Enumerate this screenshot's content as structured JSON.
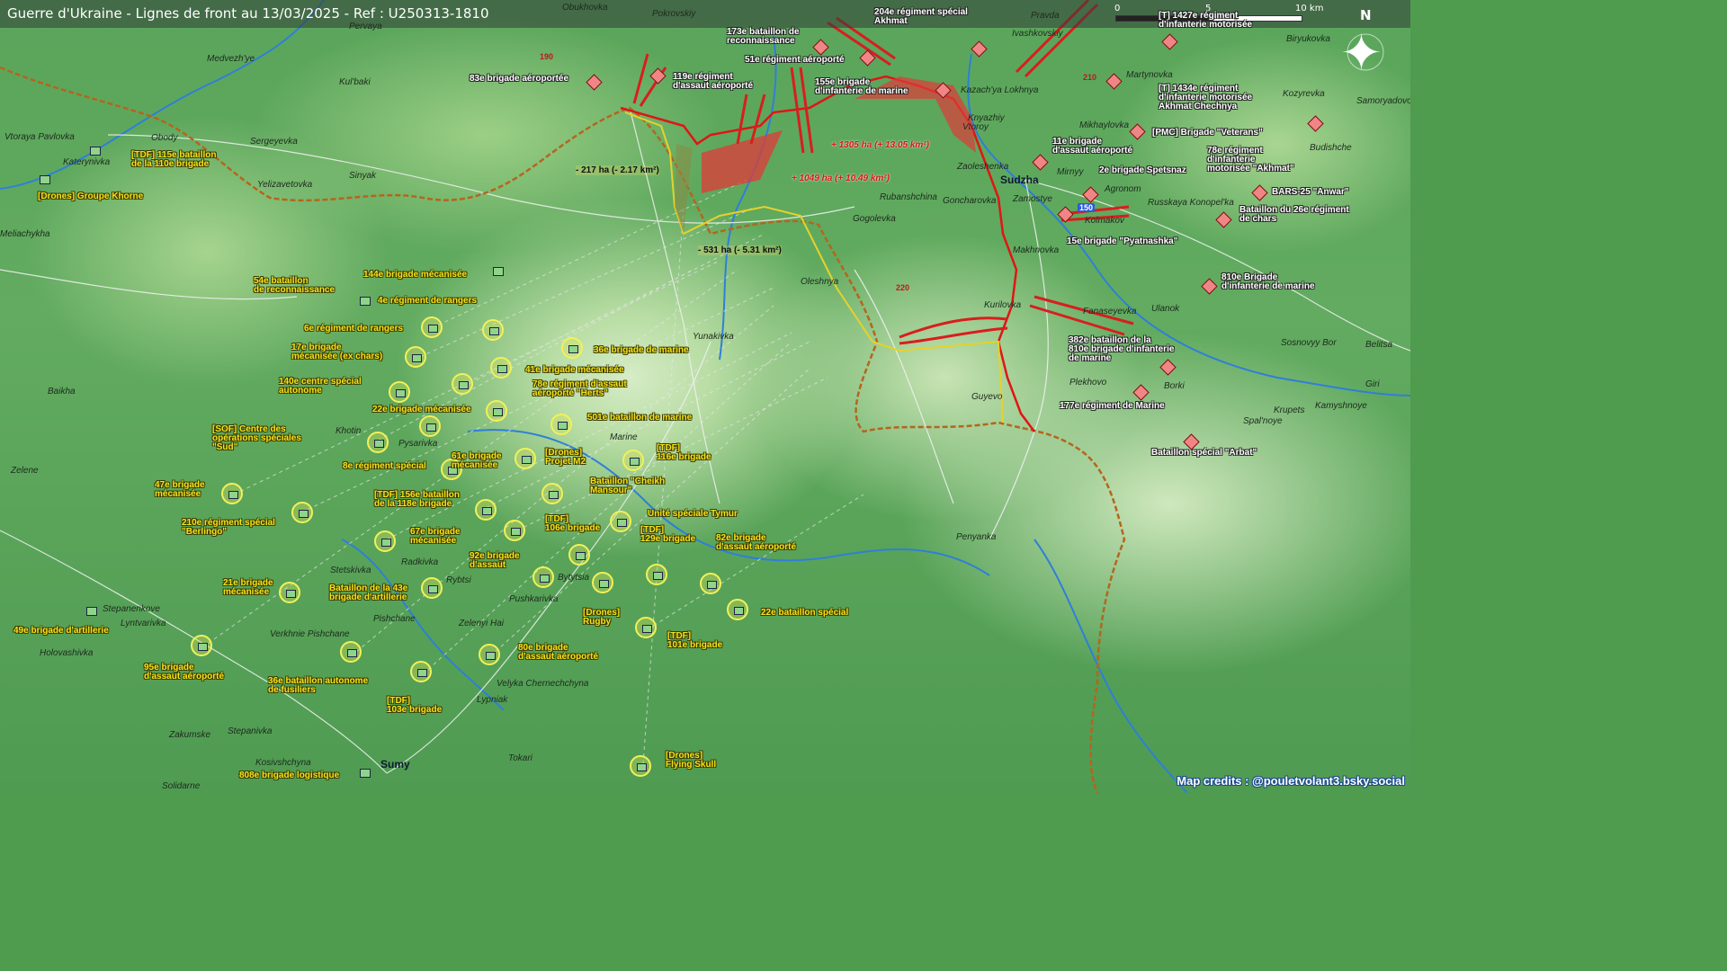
{
  "title": "Guerre d'Ukraine - Lignes de front au 13/03/2025 - Ref : U250313-1810",
  "scale": {
    "label0": "0",
    "label5": "5",
    "label10": "10 km"
  },
  "compass": "N",
  "credits": "Map credits : @pouletvolant3.bsky.social",
  "colors": {
    "russian_gain": "#e03a3a",
    "frontline": "#e01515",
    "ukraine_unit_text": "#f7e21b",
    "border": "#b5651d"
  },
  "gains": [
    {
      "text": "+ 1305 ha (+ 13.05 km²)"
    },
    {
      "text": "+ 1049 ha (+ 10.49 km²)"
    }
  ],
  "losses": [
    {
      "text": "- 217 ha (- 2.17 km²)"
    },
    {
      "text": "- 531 ha (- 5.31 km²)"
    }
  ],
  "roads": [
    "190",
    "210",
    "150",
    "220"
  ],
  "towns": [
    "Obukhovka",
    "Pokrovskiy",
    "Pervaya",
    "Pravda",
    "Ivashkovskiy",
    "Biryukovka",
    "Medvezh'ye",
    "Kul'baki",
    "Vtoraya Pavlovka",
    "Obody",
    "Katerynivka",
    "Sergeyevka",
    "Sinyak",
    "Yelizavetovka",
    "Meliachykha",
    "Kazach'ya Lokhnya",
    "Knyazhiy",
    "Vtoroy",
    "Zaoleshenka",
    "Sudzha",
    "Mirnyy",
    "Agronom",
    "Zamostye",
    "Goncharovka",
    "Rubanshchina",
    "Gogolevka",
    "Kolmakov",
    "Makhnovka",
    "Russkaya Konopel'ka",
    "Martynovka",
    "Mikhaylovka",
    "Kozyrevka",
    "Samoryadovo",
    "Budishche",
    "Oleshnya",
    "Kurilovka",
    "Fanaseyevka",
    "Ulanok",
    "Sosnovyy Bor",
    "Belitsa",
    "Plekhovo",
    "Borki",
    "Giri",
    "Krupets",
    "Kamyshnoye",
    "Spal'noye",
    "Guyevo",
    "Yunakivka",
    "Baikha",
    "Khotin",
    "Pysarivka",
    "Zelene",
    "Marine",
    "Penyanka",
    "Stetskivka",
    "Radkivka",
    "Rybtsi",
    "Bytytsia",
    "Pushkarivka",
    "Pishchane",
    "Verkhnie Pishchane",
    "Zelenyi Hai",
    "Stepanenkove",
    "Lyntvarivka",
    "Holovashivka",
    "Lypniak",
    "Velyka Chernechchyna",
    "Zakumske",
    "Stepanivka",
    "Tokari",
    "Kosivshchyna",
    "Sumy",
    "Solidarne"
  ],
  "ru_units": [
    "173e bataillon de\nreconnaissance",
    "204e régiment spécial\nAkhmat",
    "[T] 1427e régiment\nd'infanterie motorisée",
    "119e régiment\nd'assaut aéroporté",
    "83e brigade aéroportée",
    "51e régiment aéroporté",
    "155e brigade\nd'infanterie de marine",
    "[T] 1434e régiment\nd'infanterie motorisée\nAkhmat Chechnya",
    "[PMC] Brigade \"Veterans\"",
    "11e brigade\nd'assaut aéroporté",
    "78e régiment\nd'infanterie\nmotorisée \"Akhmat\"",
    "2e brigade Spetsnaz",
    "BARS-25 \"Anwar\"",
    "Bataillon du 26e régiment\nde chars",
    "15e brigade \"Pyatnashka\"",
    "810e Brigade\nd'infanterie de marine",
    "382e bataillon de la\n810e brigade d'infanterie\nde marine",
    "177e régiment de Marine",
    "Bataillon spécial \"Arbat\""
  ],
  "ua_units": [
    "[TDF] 115e bataillon\nde la 110e brigade",
    "[Drones] Groupe Khorne",
    "144e brigade mécanisée",
    "54e bataillon\nde reconnaissance",
    "4e régiment de rangers",
    "6e régiment de rangers",
    "17e brigade\nmécanisée (ex chars)",
    "36e brigade de marine",
    "41e brigade mécanisée",
    "140e centre spécial\nautonome",
    "78e régiment d'assaut\naéroporté \"Herts\"",
    "22e brigade mécanisée",
    "501e bataillon de marine",
    "[SOF] Centre des\nopérations spéciales\n\"Sud\"",
    "8e régiment spécial",
    "61e brigade\nmécanisée",
    "[Drones]\nProjet M2",
    "[TDF]\n116e brigade",
    "47e brigade\nmécanisée",
    "Bataillon \"Cheikh\nMansour\"",
    "[TDF] 156e bataillon\nde la 118e brigade",
    "210e régiment spécial\n\"Berlingo\"",
    "Unité spéciale Tymur",
    "67e brigade\nmécanisée",
    "[TDF]\n106e brigade",
    "[TDF]\n129e brigade",
    "82e brigade\nd'assaut aéroporté",
    "92e brigade\nd'assaut",
    "21e brigade\nmécanisée",
    "Bataillon de la 43e\nbrigade d'artillerie",
    "[Drones]\nRugby",
    "22e bataillon spécial",
    "49e brigade d'artillerie",
    "[TDF]\n101e brigade",
    "80e brigade\nd'assaut aéroporté",
    "95e brigade\nd'assaut aéroporté",
    "36e bataillon autonome\nde fusiliers",
    "[TDF]\n103e brigade",
    "808e brigade logistique",
    "[Drones]\nFlying Skull"
  ]
}
